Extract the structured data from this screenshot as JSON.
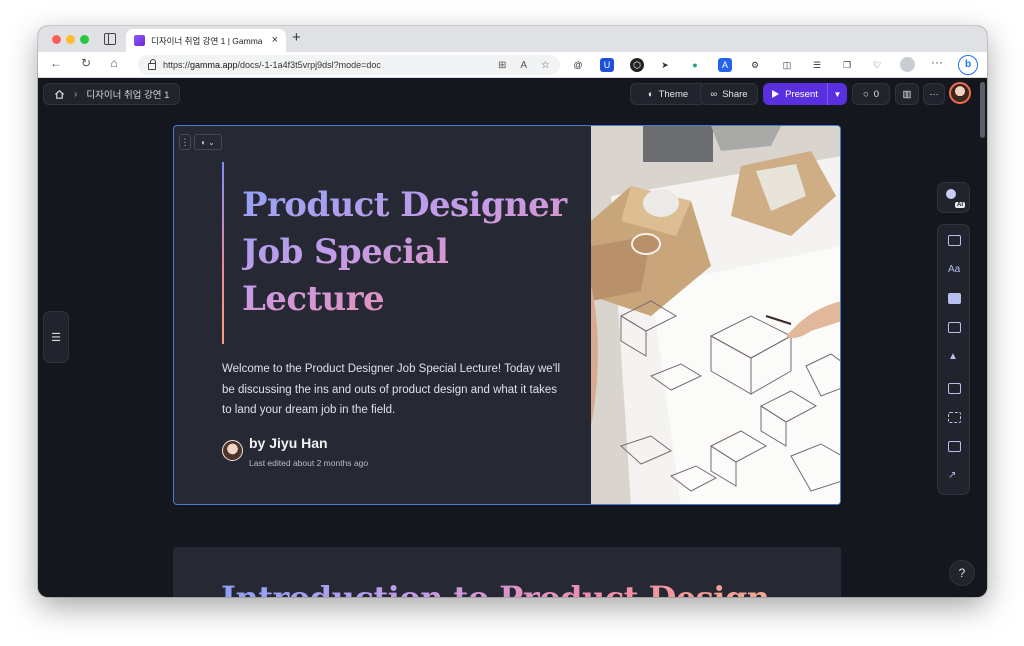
{
  "browser": {
    "tab_title": "디자이너 취업 강연 1 | Gamma",
    "tab_close": "×",
    "new_tab": "+",
    "url_prefix": "https://",
    "url_host": "gamma.app",
    "url_path": "/docs/-1-1a4f3t5vrpj9dsl?mode=doc"
  },
  "header": {
    "breadcrumb_label": "디자이너 취업 강연 1",
    "theme_label": "Theme",
    "share_label": "Share",
    "present_label": "Present",
    "comments_count": "0"
  },
  "card": {
    "title": "Product Designer Job Special Lecture",
    "description": "Welcome to the Product Designer Job Special Lecture! Today we'll be discussing the ins and outs of product design and what it takes to land your dream job in the field.",
    "author": "by Jiyu Han",
    "edited": "Last edited about 2 months ago"
  },
  "next_card": {
    "title": "Introduction to Product Design"
  },
  "rail": {
    "ai_badge": "AI",
    "tools": [
      "add-card-icon",
      "text-style-icon",
      "callout-icon",
      "layout-icon",
      "shapes-icon",
      "image-icon",
      "video-icon",
      "embed-icon",
      "chart-icon"
    ]
  },
  "help_label": "?",
  "colors": {
    "app_bg": "#15171f",
    "card_bg": "#262833",
    "accent_purple": "#5a2fe0",
    "selection_blue": "#4a7bd3",
    "title_gradient_start": "#8ea2f5",
    "title_gradient_end": "#f4a98e"
  }
}
